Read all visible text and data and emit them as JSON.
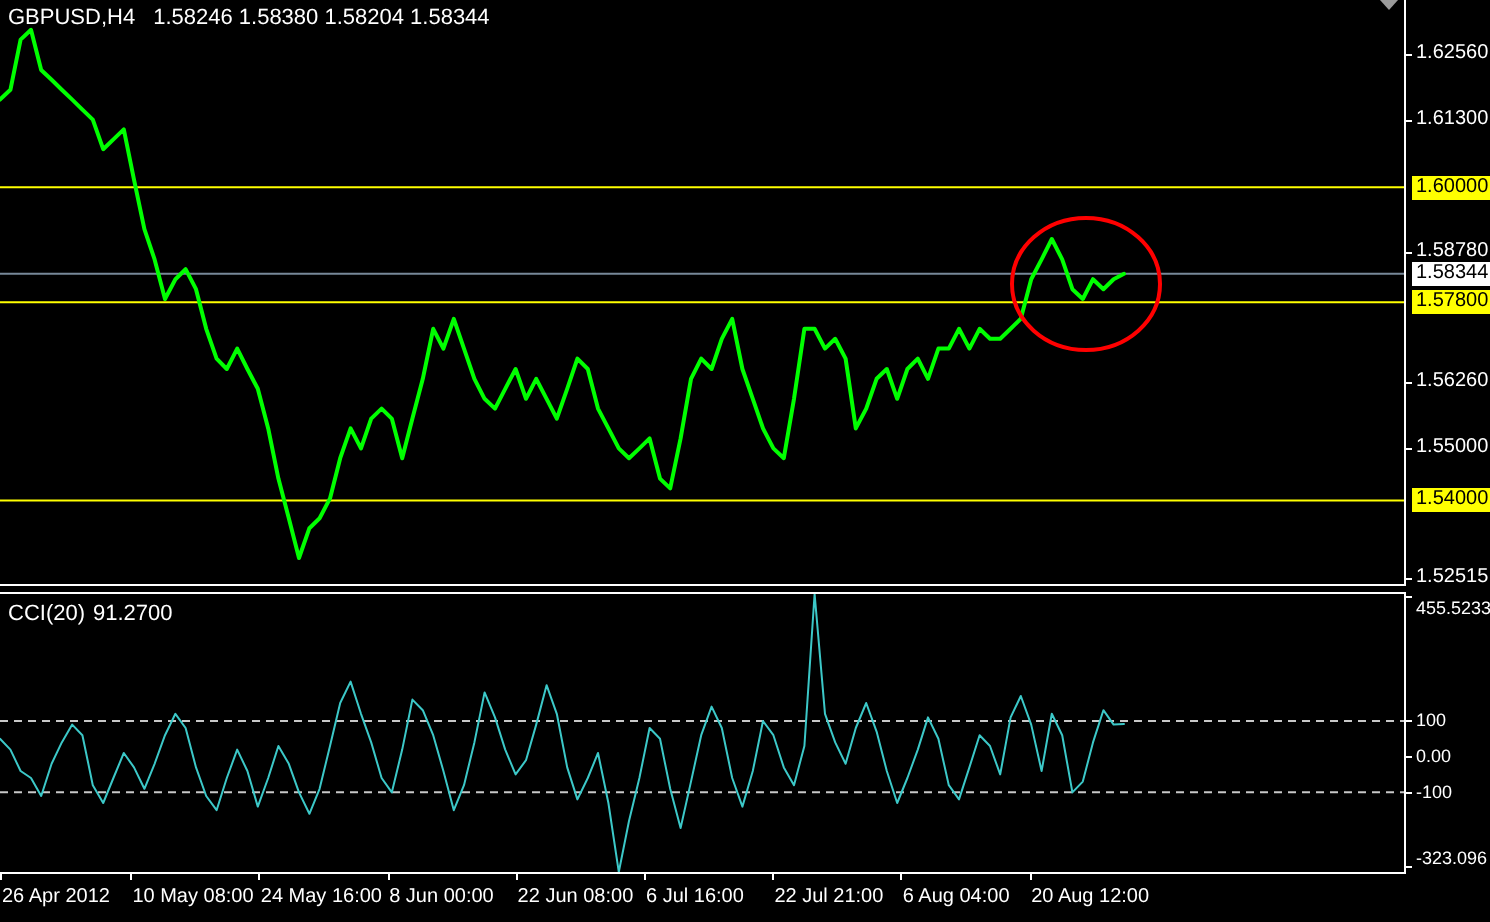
{
  "header": {
    "symbol": "GBPUSD,H4",
    "quote": "1.58246 1.58380 1.58204 1.58344"
  },
  "price_chart": {
    "chart_data": {
      "type": "line",
      "ylim": [
        1.524,
        1.6359
      ],
      "yticks": [
        {
          "value": 1.6256,
          "label": "1.62560"
        },
        {
          "value": 1.613,
          "label": "1.61300"
        },
        {
          "value": 1.5878,
          "label": "1.58780"
        },
        {
          "value": 1.5626,
          "label": "1.56260"
        },
        {
          "value": 1.55,
          "label": "1.55000"
        },
        {
          "value": 1.52515,
          "label": "1.52515"
        }
      ],
      "series": [
        {
          "color": "#00ff00",
          "values": [
            1.6168,
            1.6187,
            1.6283,
            1.6302,
            1.6225,
            1.6206,
            1.6187,
            1.6168,
            1.6149,
            1.613,
            1.6073,
            1.6092,
            1.6111,
            1.6015,
            1.592,
            1.5862,
            1.5786,
            1.5824,
            1.5843,
            1.5805,
            1.5729,
            1.5672,
            1.5652,
            1.5691,
            1.5652,
            1.5614,
            1.5538,
            1.5442,
            1.5366,
            1.529,
            1.5347,
            1.5366,
            1.5404,
            1.5481,
            1.5538,
            1.55,
            1.5557,
            1.5576,
            1.5557,
            1.5481,
            1.5557,
            1.5633,
            1.5729,
            1.5691,
            1.5748,
            1.5691,
            1.5633,
            1.5595,
            1.5576,
            1.5614,
            1.5652,
            1.5595,
            1.5633,
            1.5595,
            1.5557,
            1.5614,
            1.5672,
            1.5652,
            1.5576,
            1.5538,
            1.55,
            1.5481,
            1.55,
            1.5519,
            1.5442,
            1.5423,
            1.5519,
            1.5633,
            1.5672,
            1.5652,
            1.571,
            1.5748,
            1.5652,
            1.5595,
            1.5538,
            1.55,
            1.5481,
            1.5595,
            1.5729,
            1.5729,
            1.5691,
            1.571,
            1.5672,
            1.5538,
            1.5576,
            1.5633,
            1.5652,
            1.5595,
            1.5652,
            1.5672,
            1.5633,
            1.5691,
            1.5691,
            1.5729,
            1.5691,
            1.5729,
            1.571,
            1.571,
            1.5729,
            1.5748,
            1.5824,
            1.5862,
            1.5901,
            1.5862,
            1.5805,
            1.5786,
            1.5824,
            1.5805,
            1.5824,
            1.58344
          ]
        }
      ],
      "ref_lines": [
        {
          "axis": "y",
          "value": 1.6,
          "label": "1.60000",
          "color": "#ffff00"
        },
        {
          "axis": "y",
          "value": 1.58344,
          "color": "#778899"
        },
        {
          "axis": "y",
          "value": 1.578,
          "label": "1.57800",
          "color": "#ffff00"
        },
        {
          "axis": "y",
          "value": 1.54,
          "label": "1.54000",
          "color": "#ffff00"
        }
      ]
    },
    "current_price": "1.58344"
  },
  "indicator": {
    "value": "91.2700",
    "scale_max": "455.5233",
    "scale_min": "-323.096",
    "chart_data": {
      "type": "line",
      "ylim": [
        -323.096,
        455.5233
      ],
      "yticks": [
        100,
        {
          "value": 0,
          "label": "0.00"
        },
        -100
      ],
      "series": [
        {
          "name": "CCI(20)",
          "color": "#3cc8c8",
          "values": [
            50,
            20,
            -40,
            -60,
            -110,
            -20,
            40,
            90,
            60,
            -80,
            -130,
            -60,
            10,
            -30,
            -90,
            -20,
            60,
            120,
            80,
            -30,
            -110,
            -150,
            -60,
            20,
            -40,
            -140,
            -60,
            30,
            -20,
            -100,
            -160,
            -90,
            30,
            150,
            210,
            120,
            40,
            -60,
            -100,
            20,
            160,
            130,
            60,
            -40,
            -150,
            -80,
            40,
            180,
            110,
            20,
            -50,
            -10,
            90,
            200,
            120,
            -30,
            -120,
            -60,
            10,
            -130,
            -323.096,
            -180,
            -60,
            80,
            50,
            -90,
            -200,
            -70,
            60,
            140,
            80,
            -60,
            -140,
            -40,
            100,
            60,
            -30,
            -80,
            30,
            455.5233,
            120,
            40,
            -20,
            80,
            150,
            70,
            -40,
            -130,
            -60,
            20,
            110,
            50,
            -80,
            -120,
            -30,
            60,
            30,
            -50,
            110,
            170,
            90,
            -40,
            120,
            60,
            -100,
            -70,
            40,
            130,
            90,
            91.27
          ]
        }
      ],
      "ref_lines": [
        {
          "axis": "y",
          "value": 100
        },
        {
          "axis": "y",
          "value": -100
        }
      ]
    }
  },
  "time_axis": {
    "labels": [
      "26 Apr 2012",
      "10 May 08:00",
      "24 May 16:00",
      "8 Jun 00:00",
      "22 Jun 08:00",
      "6 Jul 16:00",
      "22 Jul 21:00",
      "6 Aug 04:00",
      "20 Aug 12:00"
    ]
  }
}
